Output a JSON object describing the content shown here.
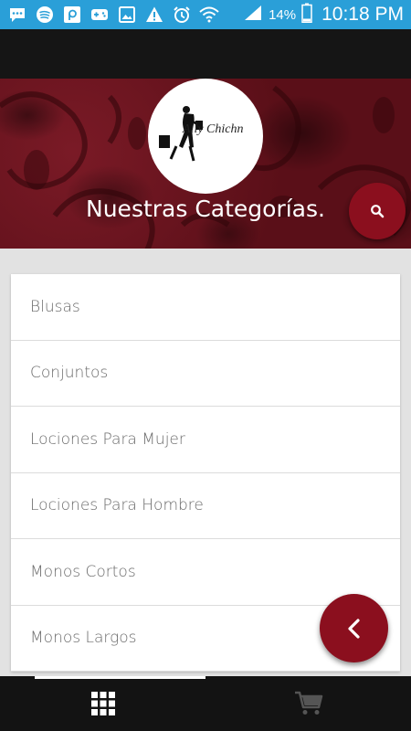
{
  "status_bar": {
    "battery_percent": "14%",
    "time": "10:18 PM",
    "icons": [
      "chat-icon",
      "spotify-icon",
      "app-icon",
      "gamepad-icon",
      "image-icon",
      "warning-icon",
      "alarm-icon",
      "wifi-icon",
      "signal-icon",
      "battery-icon"
    ]
  },
  "header": {
    "logo_text": "Ally Chichn",
    "title": "Nuestras Categorías.",
    "search_icon": "search-icon"
  },
  "categories": [
    "Blusas",
    "Conjuntos",
    "Lociones Para Mujer",
    "Lociones Para Hombre",
    "Monos Cortos",
    "Monos Largos"
  ],
  "bottom_nav": {
    "tabs": [
      "grid-icon",
      "cart-icon"
    ],
    "active_tab": "grid-icon"
  },
  "colors": {
    "status_bar": "#2a9fd8",
    "accent": "#8b0f1e",
    "header_bg": "#5a0f18",
    "bar_dark": "#151515"
  }
}
